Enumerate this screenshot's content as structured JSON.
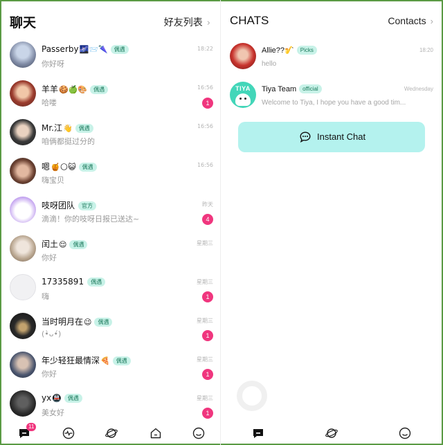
{
  "left_panel": {
    "title": "聊天",
    "friends_link": "好友列表",
    "chevron": "›",
    "chats": [
      {
        "name": "Passerby",
        "emoji": "🌌📨🌂",
        "tag": "偶遇",
        "message": "你好呀",
        "time": "18:22",
        "badge": ""
      },
      {
        "name": "羊羊",
        "emoji": "🍪🍏🎨",
        "tag": "偶遇",
        "message": "哈喽",
        "time": "16:56",
        "badge": "1"
      },
      {
        "name": "Mr.江",
        "emoji": "👋",
        "tag": "偶遇",
        "message": "咱俩都挺过分的",
        "time": "16:56",
        "badge": ""
      },
      {
        "name": "嗯",
        "emoji": "🍯🌕😺",
        "tag": "偶遇",
        "message": "嗨宝贝",
        "time": "16:56",
        "badge": ""
      },
      {
        "name": "吱呀团队",
        "emoji": "",
        "tag": "官方",
        "message": "滴滴！你的吱呀日报已送达~",
        "time": "昨天",
        "badge": "4"
      },
      {
        "name": "闰土",
        "emoji": "😌",
        "tag": "偶遇",
        "message": "你好",
        "time": "星期三",
        "badge": ""
      },
      {
        "name": "17335891",
        "emoji": "",
        "tag": "偶遇",
        "message": "嗨",
        "time": "星期三",
        "badge": "1"
      },
      {
        "name": "当时明月在",
        "emoji": "😉",
        "tag": "偶遇",
        "message": "(•̀ᴗ•́)",
        "time": "星期三",
        "badge": "1"
      },
      {
        "name": "年少轻狂最情深",
        "emoji": "🍕",
        "tag": "偶遇",
        "message": "你好",
        "time": "星期三",
        "badge": "1"
      },
      {
        "name": "yx",
        "emoji": "🚇",
        "tag": "偶遇",
        "message": "美女好",
        "time": "星期三",
        "badge": "1"
      }
    ],
    "tabs": [
      {
        "icon": "chat-bubble-icon",
        "badge": "11"
      },
      {
        "icon": "pulse-icon",
        "badge": ""
      },
      {
        "icon": "planet-icon",
        "badge": ""
      },
      {
        "icon": "home-icon",
        "badge": ""
      },
      {
        "icon": "smile-face-icon",
        "badge": ""
      }
    ]
  },
  "right_panel": {
    "title": "CHATS",
    "contacts_link": "Contacts",
    "chevron": "›",
    "chats": [
      {
        "name": "Allie??",
        "emoji": "🎷",
        "tag": "Picks",
        "message": "hello",
        "time": "18:20"
      },
      {
        "name": "Tiya Team",
        "emoji": "",
        "tag": "official",
        "message": "Welcome to Tiya, I hope you have a good tim...",
        "time": "Wednesday",
        "avatar_text": "TIYA"
      }
    ],
    "instant_chat_label": "Instant Chat",
    "tabs": [
      {
        "icon": "chat-bubble-icon"
      },
      {
        "icon": "planet-icon"
      },
      {
        "icon": "smile-face-icon"
      }
    ]
  },
  "colors": {
    "accent_pink": "#f0367e",
    "tag_green_bg": "#c8f2e8",
    "instant_button": "#b4f2ee",
    "frame_border": "#5a9a44"
  }
}
